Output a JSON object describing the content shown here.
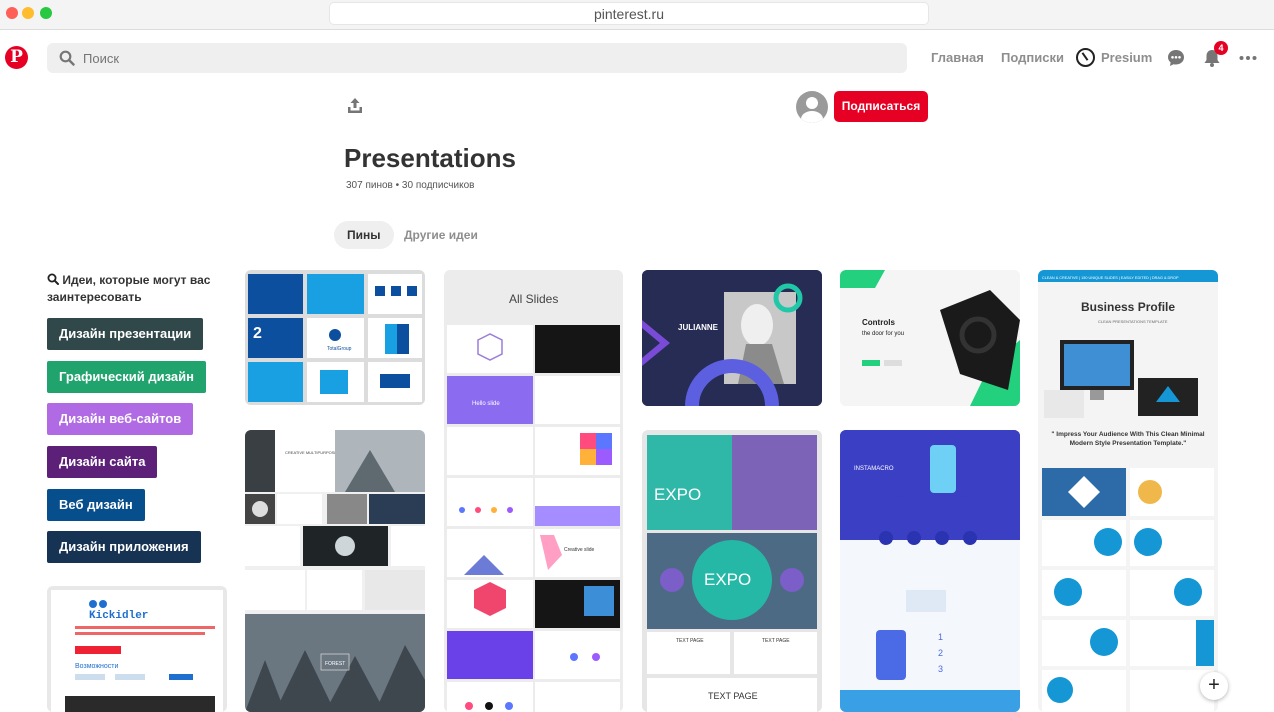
{
  "browser": {
    "url": "pinterest.ru"
  },
  "nav": {
    "logo": "P",
    "search_placeholder": "Поиск",
    "home": "Главная",
    "following": "Подписки",
    "profile": "Presium",
    "notifications_count": "4"
  },
  "board": {
    "title": "Presentations",
    "meta": "307 пинов • 30 подписчиков",
    "follow_label": "Подписаться",
    "tabs": [
      "Пины",
      "Другие идеи"
    ]
  },
  "ideas": {
    "heading": "Идеи, которые могут вас заинтересовать",
    "chips": [
      {
        "label": "Дизайн презентации",
        "color": "#31484a"
      },
      {
        "label": "Графический дизайн",
        "color": "#21a36d"
      },
      {
        "label": "Дизайн веб-сайтов",
        "color": "#b06ae4"
      },
      {
        "label": "Дизайн сайта",
        "color": "#5c2079"
      },
      {
        "label": "Веб дизайн",
        "color": "#074e8c"
      },
      {
        "label": "Дизайн приложения",
        "color": "#173353"
      }
    ]
  },
  "pins": {
    "kickidler": {
      "brand": "Kickidler",
      "section": "Возможности"
    },
    "all_slides": {
      "title": "All Slides",
      "slide1": "Hello slide",
      "slide2": "Creative slide"
    },
    "julianne": {
      "name": "JULIANNE"
    },
    "controls": {
      "heading": "Controls",
      "subheading": "the door for you"
    },
    "business": {
      "tags": "CLEAN & CREATIVE | 150 UNIQUE SLIDES | EASILY EDITED | DRAG & DROP",
      "title": "Business Profile",
      "subtitle": "CLEAN PRESENTATIONS TEMPLATE",
      "quote": "\" Impress Your Audience With This Clean Minimal Modern Style Presentation Template.\""
    },
    "creative": {
      "title": "CREATIVE MULTIPURPOSE TEMPLATE",
      "forest": "FOREST"
    },
    "expo": {
      "title1": "EXPO",
      "title2": "EXPO",
      "textpage1": "TEXT PAGE",
      "textpage2": "TEXT PAGE",
      "textpage3": "TEXT PAGE"
    },
    "instamacro": {
      "title": "INSTAMACRO",
      "steps": [
        "1",
        "2",
        "3"
      ]
    },
    "totalgroup": {
      "number": "2",
      "brand": "TotalGroup"
    }
  },
  "colors": {
    "brand_red": "#e60023",
    "muted_text": "#8e8e8e"
  }
}
